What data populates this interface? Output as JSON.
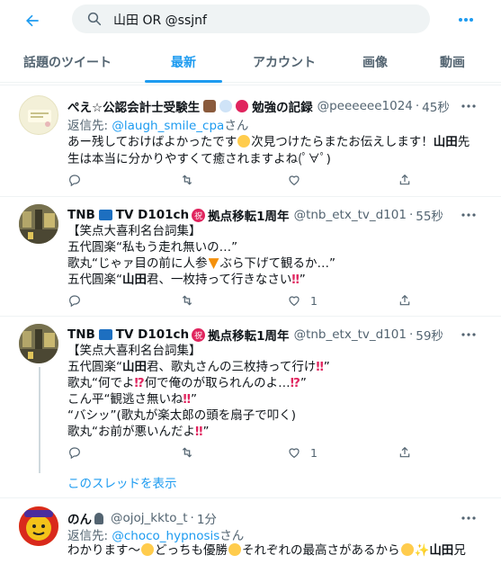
{
  "search": {
    "query": "山田 OR @ssjnf"
  },
  "tabs": [
    {
      "label": "話題のツイート"
    },
    {
      "label": "最新"
    },
    {
      "label": "アカウント"
    },
    {
      "label": "画像"
    },
    {
      "label": "動画"
    }
  ],
  "posts": [
    {
      "name": "ぺえ☆公認会計士受験生",
      "name_suffix": "勉強の記録",
      "handle": "@peeeeee1024",
      "time": "45秒",
      "reply_prefix": "返信先:",
      "reply_mention": "@laugh_smile_cpa",
      "reply_suffix": "さん",
      "line1_a": "あー残しておけばよかったです",
      "line1_b": "次見つけたらまたお伝えします！",
      "line1_hl": "山田",
      "line1_c": "先",
      "line2": "生は本当に分かりやすくて癒されますよね(ﾟ∀ﾟ)",
      "reply_count": "",
      "retweet_count": "",
      "like_count": ""
    },
    {
      "name": "TNB",
      "name_mid": "TV D101ch",
      "name_suffix": "拠点移転1周年",
      "handle": "@tnb_etx_tv_d101",
      "time": "55秒",
      "lines": [
        "【笑点大喜利名台詞集】",
        "五代圓楽“私もう走れ無いの…”",
        "歌丸“じゃァ目の前に人参",
        "ぶら下げて観るか…”"
      ],
      "line4_a": "五代圓楽“",
      "line4_hl": "山田",
      "line4_b": "君、一枚持って行きなさい",
      "line4_end": "”",
      "reply_count": "",
      "retweet_count": "",
      "like_count": "1"
    },
    {
      "name": "TNB",
      "name_mid": "TV D101ch",
      "name_suffix": "拠点移転1周年",
      "handle": "@tnb_etx_tv_d101",
      "time": "59秒",
      "line1": "【笑点大喜利名台詞集】",
      "line2_a": "五代圓楽“",
      "line2_hl": "山田",
      "line2_b": "君、歌丸さんの三枚持って行け",
      "line2_end": "”",
      "line3_a": "歌丸“何でよ",
      "line3_b": "何で俺のが取られんのよ…",
      "line3_end": "”",
      "line4_a": "こん平“観逃さ無いね",
      "line4_end": "”",
      "line5_a": "“バシッ”(歌丸が楽太郎の頭を扇子で叩く)",
      "line6_a": "歌丸“お前が悪いんだよ",
      "line6_end": "”",
      "reply_count": "",
      "retweet_count": "",
      "like_count": "1",
      "thread_link": "このスレッドを表示"
    },
    {
      "name": "のん",
      "handle": "@ojoj_kkto_t",
      "time": "1分",
      "reply_prefix": "返信先:",
      "reply_mention": "@choco_hypnosis",
      "reply_suffix": "さん",
      "line1_a": "わかります〜",
      "line1_b": "どっちも優勝",
      "line1_c": "それぞれの最高さがあるから",
      "line1_hl": "山田",
      "line1_d": "兄"
    }
  ],
  "colors": {
    "accent": "#1d9bf0",
    "text": "#0f1419",
    "muted": "#536471",
    "like": "#f91880",
    "alert": "#e0245e"
  }
}
